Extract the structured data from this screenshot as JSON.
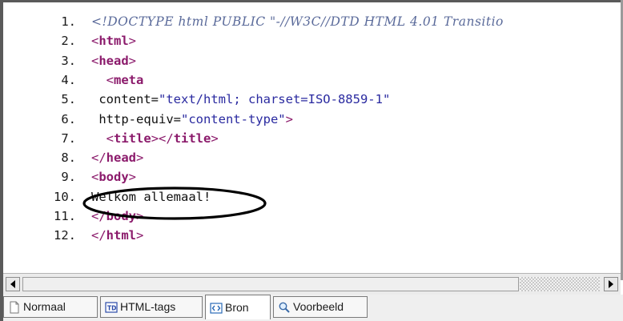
{
  "editor": {
    "lines": [
      {
        "num": "1.",
        "tokens": [
          {
            "t": "doctype",
            "v": "<!DOCTYPE html PUBLIC \"-//W3C//DTD HTML 4.01 Transitio"
          }
        ]
      },
      {
        "num": "2.",
        "tokens": [
          {
            "t": "punct",
            "v": "<"
          },
          {
            "t": "tag",
            "v": "html"
          },
          {
            "t": "punct",
            "v": ">"
          }
        ]
      },
      {
        "num": "3.",
        "tokens": [
          {
            "t": "punct",
            "v": "<"
          },
          {
            "t": "tag",
            "v": "head"
          },
          {
            "t": "punct",
            "v": ">"
          }
        ]
      },
      {
        "num": "4.",
        "tokens": [
          {
            "t": "text",
            "v": "  "
          },
          {
            "t": "punct",
            "v": "<"
          },
          {
            "t": "tag",
            "v": "meta"
          }
        ]
      },
      {
        "num": "5.",
        "tokens": [
          {
            "t": "attr",
            "v": " content="
          },
          {
            "t": "str",
            "v": "\"text/html; charset=ISO-8859-1\""
          }
        ]
      },
      {
        "num": "6.",
        "tokens": [
          {
            "t": "attr",
            "v": " http-equiv="
          },
          {
            "t": "str",
            "v": "\"content-type\""
          },
          {
            "t": "punct",
            "v": ">"
          }
        ]
      },
      {
        "num": "7.",
        "tokens": [
          {
            "t": "text",
            "v": "  "
          },
          {
            "t": "punct",
            "v": "<"
          },
          {
            "t": "tag",
            "v": "title"
          },
          {
            "t": "punct",
            "v": "></"
          },
          {
            "t": "tag",
            "v": "title"
          },
          {
            "t": "punct",
            "v": ">"
          }
        ]
      },
      {
        "num": "8.",
        "tokens": [
          {
            "t": "punct",
            "v": "</"
          },
          {
            "t": "tag",
            "v": "head"
          },
          {
            "t": "punct",
            "v": ">"
          }
        ]
      },
      {
        "num": "9.",
        "tokens": [
          {
            "t": "punct",
            "v": "<"
          },
          {
            "t": "tag",
            "v": "body"
          },
          {
            "t": "punct",
            "v": ">"
          }
        ]
      },
      {
        "num": "10.",
        "tokens": [
          {
            "t": "text",
            "v": "Welkom allemaal!"
          }
        ]
      },
      {
        "num": "11.",
        "tokens": [
          {
            "t": "punct",
            "v": "</"
          },
          {
            "t": "tag",
            "v": "body"
          },
          {
            "t": "punct",
            "v": ">"
          }
        ]
      },
      {
        "num": "12.",
        "tokens": [
          {
            "t": "punct",
            "v": "</"
          },
          {
            "t": "tag",
            "v": "html"
          },
          {
            "t": "punct",
            "v": ">"
          }
        ]
      }
    ]
  },
  "scrollbar": {
    "left_icon": "arrow-left-icon",
    "right_icon": "arrow-right-icon"
  },
  "tabs": [
    {
      "id": "normaal",
      "label": "Normaal",
      "icon": "page-icon",
      "active": false
    },
    {
      "id": "html-tags",
      "label": "HTML-tags",
      "icon": "td-tag-icon",
      "active": false
    },
    {
      "id": "bron",
      "label": "Bron",
      "icon": "source-code-icon",
      "active": true
    },
    {
      "id": "voorbeeld",
      "label": "Voorbeeld",
      "icon": "magnifier-icon",
      "active": false
    }
  ],
  "colors": {
    "tag": "#8b1a6b",
    "string": "#2a2aa0",
    "doctype": "#5a6a9a",
    "text": "#101010",
    "annotation": "#000000"
  }
}
